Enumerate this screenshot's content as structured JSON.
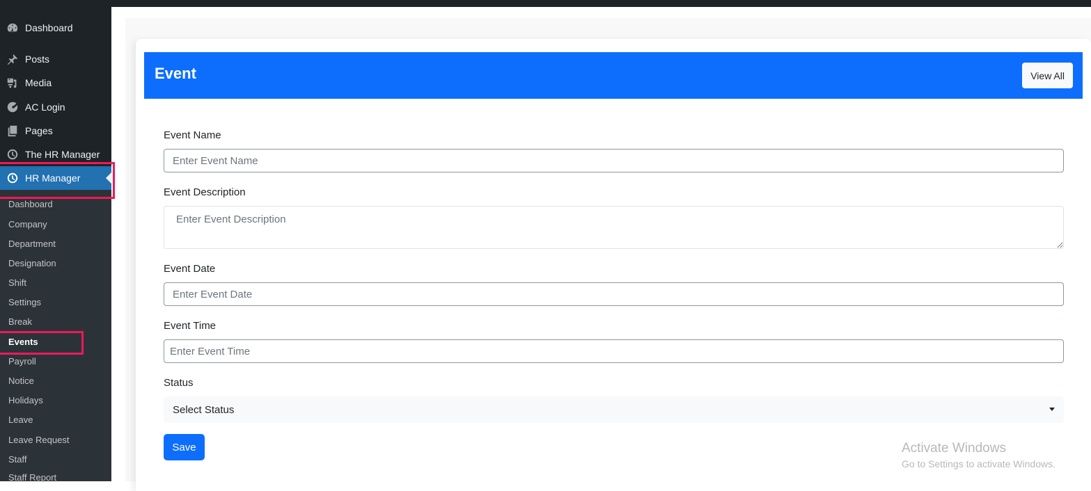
{
  "sidebar": {
    "menu": [
      {
        "label": "Dashboard",
        "icon": "dashboard-icon"
      },
      {
        "label": "Posts",
        "icon": "pin-icon"
      },
      {
        "label": "Media",
        "icon": "media-icon"
      },
      {
        "label": "AC Login",
        "icon": "ac-login-icon"
      },
      {
        "label": "Pages",
        "icon": "pages-icon"
      },
      {
        "label": "The HR Manager",
        "icon": "clock-icon"
      },
      {
        "label": "HR Manager",
        "icon": "clock-icon",
        "active": true
      }
    ],
    "submenu": [
      "Dashboard",
      "Company",
      "Department",
      "Designation",
      "Shift",
      "Settings",
      "Break",
      "Events",
      "Payroll",
      "Notice",
      "Holidays",
      "Leave",
      "Leave Request",
      "Staff",
      "Staff Report"
    ],
    "current_submenu": "Events",
    "highlight_color": "#f0185a"
  },
  "card": {
    "title": "Event",
    "view_all_label": "View All",
    "header_color": "#0d6efd"
  },
  "form": {
    "event_name": {
      "label": "Event Name",
      "placeholder": "Enter Event Name",
      "value": ""
    },
    "event_description": {
      "label": "Event Description",
      "placeholder": "Enter Event Description",
      "value": ""
    },
    "event_date": {
      "label": "Event Date",
      "placeholder": "Enter Event Date",
      "value": ""
    },
    "event_time": {
      "label": "Event Time",
      "placeholder": "Enter Event Time",
      "value": ""
    },
    "status": {
      "label": "Status",
      "selected": "Select Status"
    },
    "save_label": "Save"
  },
  "watermark": {
    "line1": "Activate Windows",
    "line2": "Go to Settings to activate Windows."
  }
}
